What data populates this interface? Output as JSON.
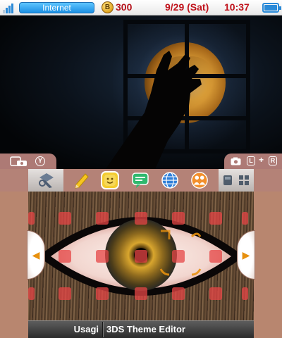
{
  "status_bar": {
    "connection_label": "Internet",
    "coin_glyph": "B",
    "coin_count": "300",
    "date": "9/29 (Sat)",
    "time": "10:37",
    "battery_level": 1.0,
    "icons": [
      "signal-icon",
      "coin-icon",
      "battery-icon"
    ]
  },
  "top_screen_footer": {
    "left_glyphs": {
      "camera_screenshot": "camera-icon",
      "y_button": "Y"
    },
    "right_glyphs": {
      "camera": "camera-icon",
      "l_button": "L",
      "plus": "+",
      "r_button": "R"
    }
  },
  "icon_bar": {
    "apps": [
      {
        "name": "settings-tool-icon"
      },
      {
        "name": "notes-pencil-icon"
      },
      {
        "name": "smiley-icon"
      },
      {
        "name": "chat-bubble-icon"
      },
      {
        "name": "globe-icon"
      },
      {
        "name": "friends-icon"
      },
      {
        "name": "single-view-icon"
      },
      {
        "name": "grid-view-icon"
      }
    ]
  },
  "bottom_bar": {
    "user_name": "Usagi",
    "title": "3DS Theme Editor"
  },
  "colors": {
    "accent_red": "#c0121b",
    "internet_blue": "#1c8fe3",
    "frame_rose": "#b8866f",
    "grid_red": "#e64646"
  }
}
